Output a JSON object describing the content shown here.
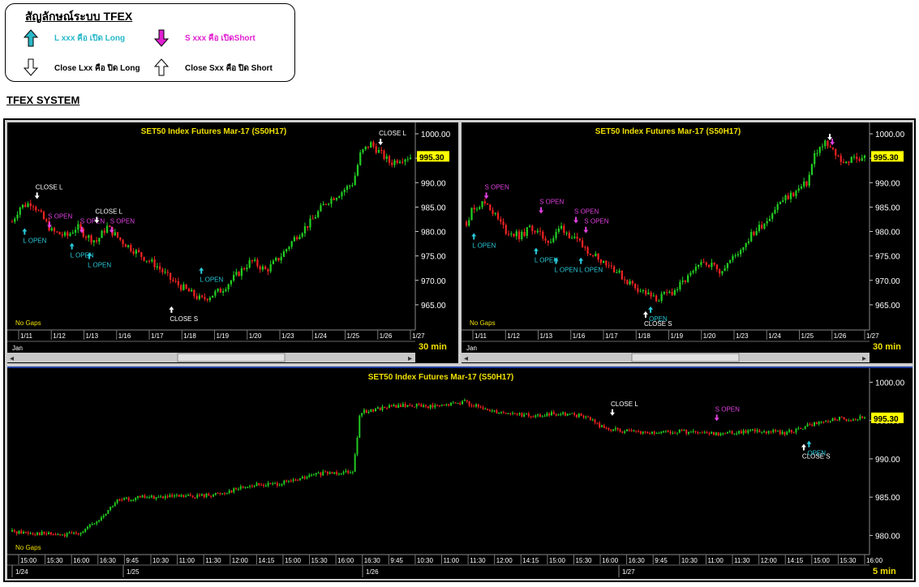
{
  "legend": {
    "title": "สัญลักษณ์ระบบ TFEX",
    "items": [
      {
        "label": "L xxx คือ เปิด Long",
        "color": "#29b8c8",
        "icon": "arrow-up-cyan"
      },
      {
        "label": "S xxx คือ เปิดShort",
        "color": "#e020d0",
        "icon": "arrow-down-magenta"
      },
      {
        "label": "Close Lxx คือ ปิด Long",
        "color": "#000000",
        "icon": "arrow-down-outline"
      },
      {
        "label": "Close Sxx คือ ปิด Short",
        "color": "#000000",
        "icon": "arrow-up-outline"
      }
    ]
  },
  "section_title": "TFEX SYSTEM",
  "chart_data": [
    {
      "type": "candlestick",
      "title": "SET50  Index  Futures  Mar-17  (S50H17)",
      "interval": "30  min",
      "no_gaps": "No Gaps",
      "month_label": "Jan",
      "last_price": "995.30",
      "ylim": [
        962,
        1001
      ],
      "y_ticks": [
        "1000.00",
        "995.00",
        "990.00",
        "985.00",
        "980.00",
        "975.00",
        "970.00",
        "965.00"
      ],
      "x_ticks": [
        "1/11",
        "1/12",
        "1/13",
        "1/16",
        "1/17",
        "1/18",
        "1/19",
        "1/20",
        "1/23",
        "1/24",
        "1/25",
        "1/26",
        "1/27"
      ],
      "close_path": [
        [
          0,
          982
        ],
        [
          3,
          985
        ],
        [
          8,
          986
        ],
        [
          12,
          983
        ],
        [
          16,
          980
        ],
        [
          22,
          979
        ],
        [
          26,
          981
        ],
        [
          30,
          979
        ],
        [
          34,
          978
        ],
        [
          38,
          981
        ],
        [
          44,
          978
        ],
        [
          52,
          975
        ],
        [
          58,
          973
        ],
        [
          64,
          970
        ],
        [
          70,
          968
        ],
        [
          76,
          966
        ],
        [
          84,
          968
        ],
        [
          90,
          971
        ],
        [
          96,
          974
        ],
        [
          102,
          972
        ],
        [
          108,
          975
        ],
        [
          114,
          979
        ],
        [
          120,
          982
        ],
        [
          126,
          986
        ],
        [
          132,
          988
        ],
        [
          137,
          990
        ],
        [
          140,
          996
        ],
        [
          144,
          998
        ],
        [
          148,
          996
        ],
        [
          152,
          994
        ],
        [
          156,
          995
        ],
        [
          160,
          995.3
        ]
      ],
      "annotations": [
        {
          "text": "CLOSE  L",
          "kind": "close_long",
          "x": 10,
          "y": 986
        },
        {
          "text": "L  OPEN",
          "kind": "open_long",
          "x": 5,
          "y": 982
        },
        {
          "text": "S  OPEN",
          "kind": "open_short",
          "x": 15,
          "y": 980
        },
        {
          "text": "L  OPEN",
          "kind": "open_long",
          "x": 24,
          "y": 979
        },
        {
          "text": "S  OPEN",
          "kind": "open_short",
          "x": 28,
          "y": 979
        },
        {
          "text": "L  OPEN",
          "kind": "open_long",
          "x": 31,
          "y": 977
        },
        {
          "text": "CLOSE  L",
          "kind": "close_long",
          "x": 34,
          "y": 981
        },
        {
          "text": "S  OPEN",
          "kind": "open_short",
          "x": 40,
          "y": 979
        },
        {
          "text": "CLOSE  S",
          "kind": "close_short",
          "x": 64,
          "y": 966
        },
        {
          "text": "L  OPEN",
          "kind": "open_long",
          "x": 76,
          "y": 974
        },
        {
          "text": "CLOSE  L",
          "kind": "close_long",
          "x": 148,
          "y": 997
        }
      ]
    },
    {
      "type": "candlestick",
      "title": "SET50  Index  Futures  Mar-17  (S50H17)",
      "interval": "30  min",
      "no_gaps": "No Gaps",
      "month_label": "Jan",
      "last_price": "995.30",
      "ylim": [
        962,
        1001
      ],
      "y_ticks": [
        "1000.00",
        "995.00",
        "990.00",
        "985.00",
        "980.00",
        "975.00",
        "970.00",
        "965.00"
      ],
      "x_ticks": [
        "1/11",
        "1/12",
        "1/13",
        "1/16",
        "1/17",
        "1/18",
        "1/19",
        "1/20",
        "1/23",
        "1/24",
        "1/25",
        "1/26",
        "1/27"
      ],
      "close_path": [
        [
          0,
          982
        ],
        [
          3,
          985
        ],
        [
          8,
          986
        ],
        [
          12,
          983
        ],
        [
          16,
          980
        ],
        [
          22,
          979
        ],
        [
          26,
          981
        ],
        [
          30,
          979
        ],
        [
          34,
          978
        ],
        [
          38,
          981
        ],
        [
          44,
          978
        ],
        [
          52,
          975
        ],
        [
          58,
          973
        ],
        [
          64,
          970
        ],
        [
          70,
          968
        ],
        [
          76,
          966
        ],
        [
          84,
          968
        ],
        [
          90,
          971
        ],
        [
          96,
          974
        ],
        [
          102,
          972
        ],
        [
          108,
          975
        ],
        [
          114,
          979
        ],
        [
          120,
          982
        ],
        [
          126,
          986
        ],
        [
          132,
          988
        ],
        [
          137,
          990
        ],
        [
          140,
          996
        ],
        [
          144,
          998
        ],
        [
          148,
          996
        ],
        [
          152,
          994
        ],
        [
          156,
          995
        ],
        [
          160,
          995.3
        ]
      ],
      "annotations": [
        {
          "text": "S  OPEN",
          "kind": "open_short",
          "x": 8,
          "y": 986
        },
        {
          "text": "L  OPEN",
          "kind": "open_long",
          "x": 3,
          "y": 981
        },
        {
          "text": "S  OPEN",
          "kind": "open_short",
          "x": 30,
          "y": 983
        },
        {
          "text": "L  OPEN",
          "kind": "open_long",
          "x": 28,
          "y": 978
        },
        {
          "text": "L  OPEN",
          "kind": "open_long",
          "x": 36,
          "y": 976
        },
        {
          "text": "S  OPEN",
          "kind": "open_short",
          "x": 44,
          "y": 981
        },
        {
          "text": "S  OPEN",
          "kind": "open_short",
          "x": 48,
          "y": 979
        },
        {
          "text": "L  OPEN",
          "kind": "open_long",
          "x": 46,
          "y": 976
        },
        {
          "text": "CLOSE  S",
          "kind": "close_short",
          "x": 72,
          "y": 965
        },
        {
          "text": "OPEN",
          "kind": "open_long",
          "x": 74,
          "y": 966
        },
        {
          "text": "",
          "kind": "close_long",
          "x": 146,
          "y": 998
        },
        {
          "text": "",
          "kind": "open_short",
          "x": 147,
          "y": 997
        }
      ]
    },
    {
      "type": "candlestick",
      "title": "SET50  Index  Futures  Mar-17  (S50H17)",
      "interval": "5  min",
      "no_gaps": "No Gaps",
      "last_price": "995.30",
      "ylim": [
        977.5,
        1001
      ],
      "y_ticks": [
        "1000.00",
        "995.00",
        "990.00",
        "985.00",
        "980.00"
      ],
      "x_ticks": [
        "15:00",
        "15:30",
        "16:00",
        "16:30",
        "9:45",
        "10:30",
        "11:00",
        "11:30",
        "12:00",
        "14:15",
        "15:00",
        "15:30",
        "16:00",
        "16:30",
        "9:45",
        "10:30",
        "11:00",
        "11:30",
        "12:00",
        "14:15",
        "15:00",
        "15:30",
        "16:00",
        "16:30",
        "9:45",
        "10:30",
        "11:00",
        "11:30",
        "12:00",
        "14:15",
        "15:00",
        "15:30",
        "16:00"
      ],
      "day_labels": [
        "1/24",
        "1/25",
        "1/26",
        "1/27"
      ],
      "close_path": [
        [
          0,
          980.5
        ],
        [
          15,
          980.3
        ],
        [
          30,
          980
        ],
        [
          40,
          980.5
        ],
        [
          50,
          982
        ],
        [
          60,
          984.5
        ],
        [
          75,
          985
        ],
        [
          90,
          985
        ],
        [
          110,
          985.2
        ],
        [
          120,
          985.5
        ],
        [
          135,
          986.5
        ],
        [
          150,
          986.7
        ],
        [
          160,
          987
        ],
        [
          175,
          988
        ],
        [
          190,
          988.3
        ],
        [
          196,
          988.5
        ],
        [
          200,
          996
        ],
        [
          215,
          996.8
        ],
        [
          230,
          997
        ],
        [
          245,
          996.8
        ],
        [
          260,
          997.5
        ],
        [
          270,
          996.5
        ],
        [
          285,
          996
        ],
        [
          300,
          995.5
        ],
        [
          315,
          996
        ],
        [
          330,
          995.5
        ],
        [
          340,
          994
        ],
        [
          355,
          993.5
        ],
        [
          370,
          993.3
        ],
        [
          385,
          993.6
        ],
        [
          400,
          993.2
        ],
        [
          415,
          993.5
        ],
        [
          430,
          993.7
        ],
        [
          445,
          993.4
        ],
        [
          460,
          994.5
        ],
        [
          475,
          995.2
        ],
        [
          490,
          995.3
        ]
      ],
      "annotations": [
        {
          "text": "CLOSE  L",
          "kind": "close_long",
          "x": 345,
          "y": 995.2
        },
        {
          "text": "S  OPEN",
          "kind": "open_short",
          "x": 405,
          "y": 994.5
        },
        {
          "text": "CLOSE  S",
          "kind": "close_short",
          "x": 455,
          "y": 992.8
        },
        {
          "text": "OPEN",
          "kind": "open_long",
          "x": 458,
          "y": 993.2
        }
      ]
    }
  ]
}
